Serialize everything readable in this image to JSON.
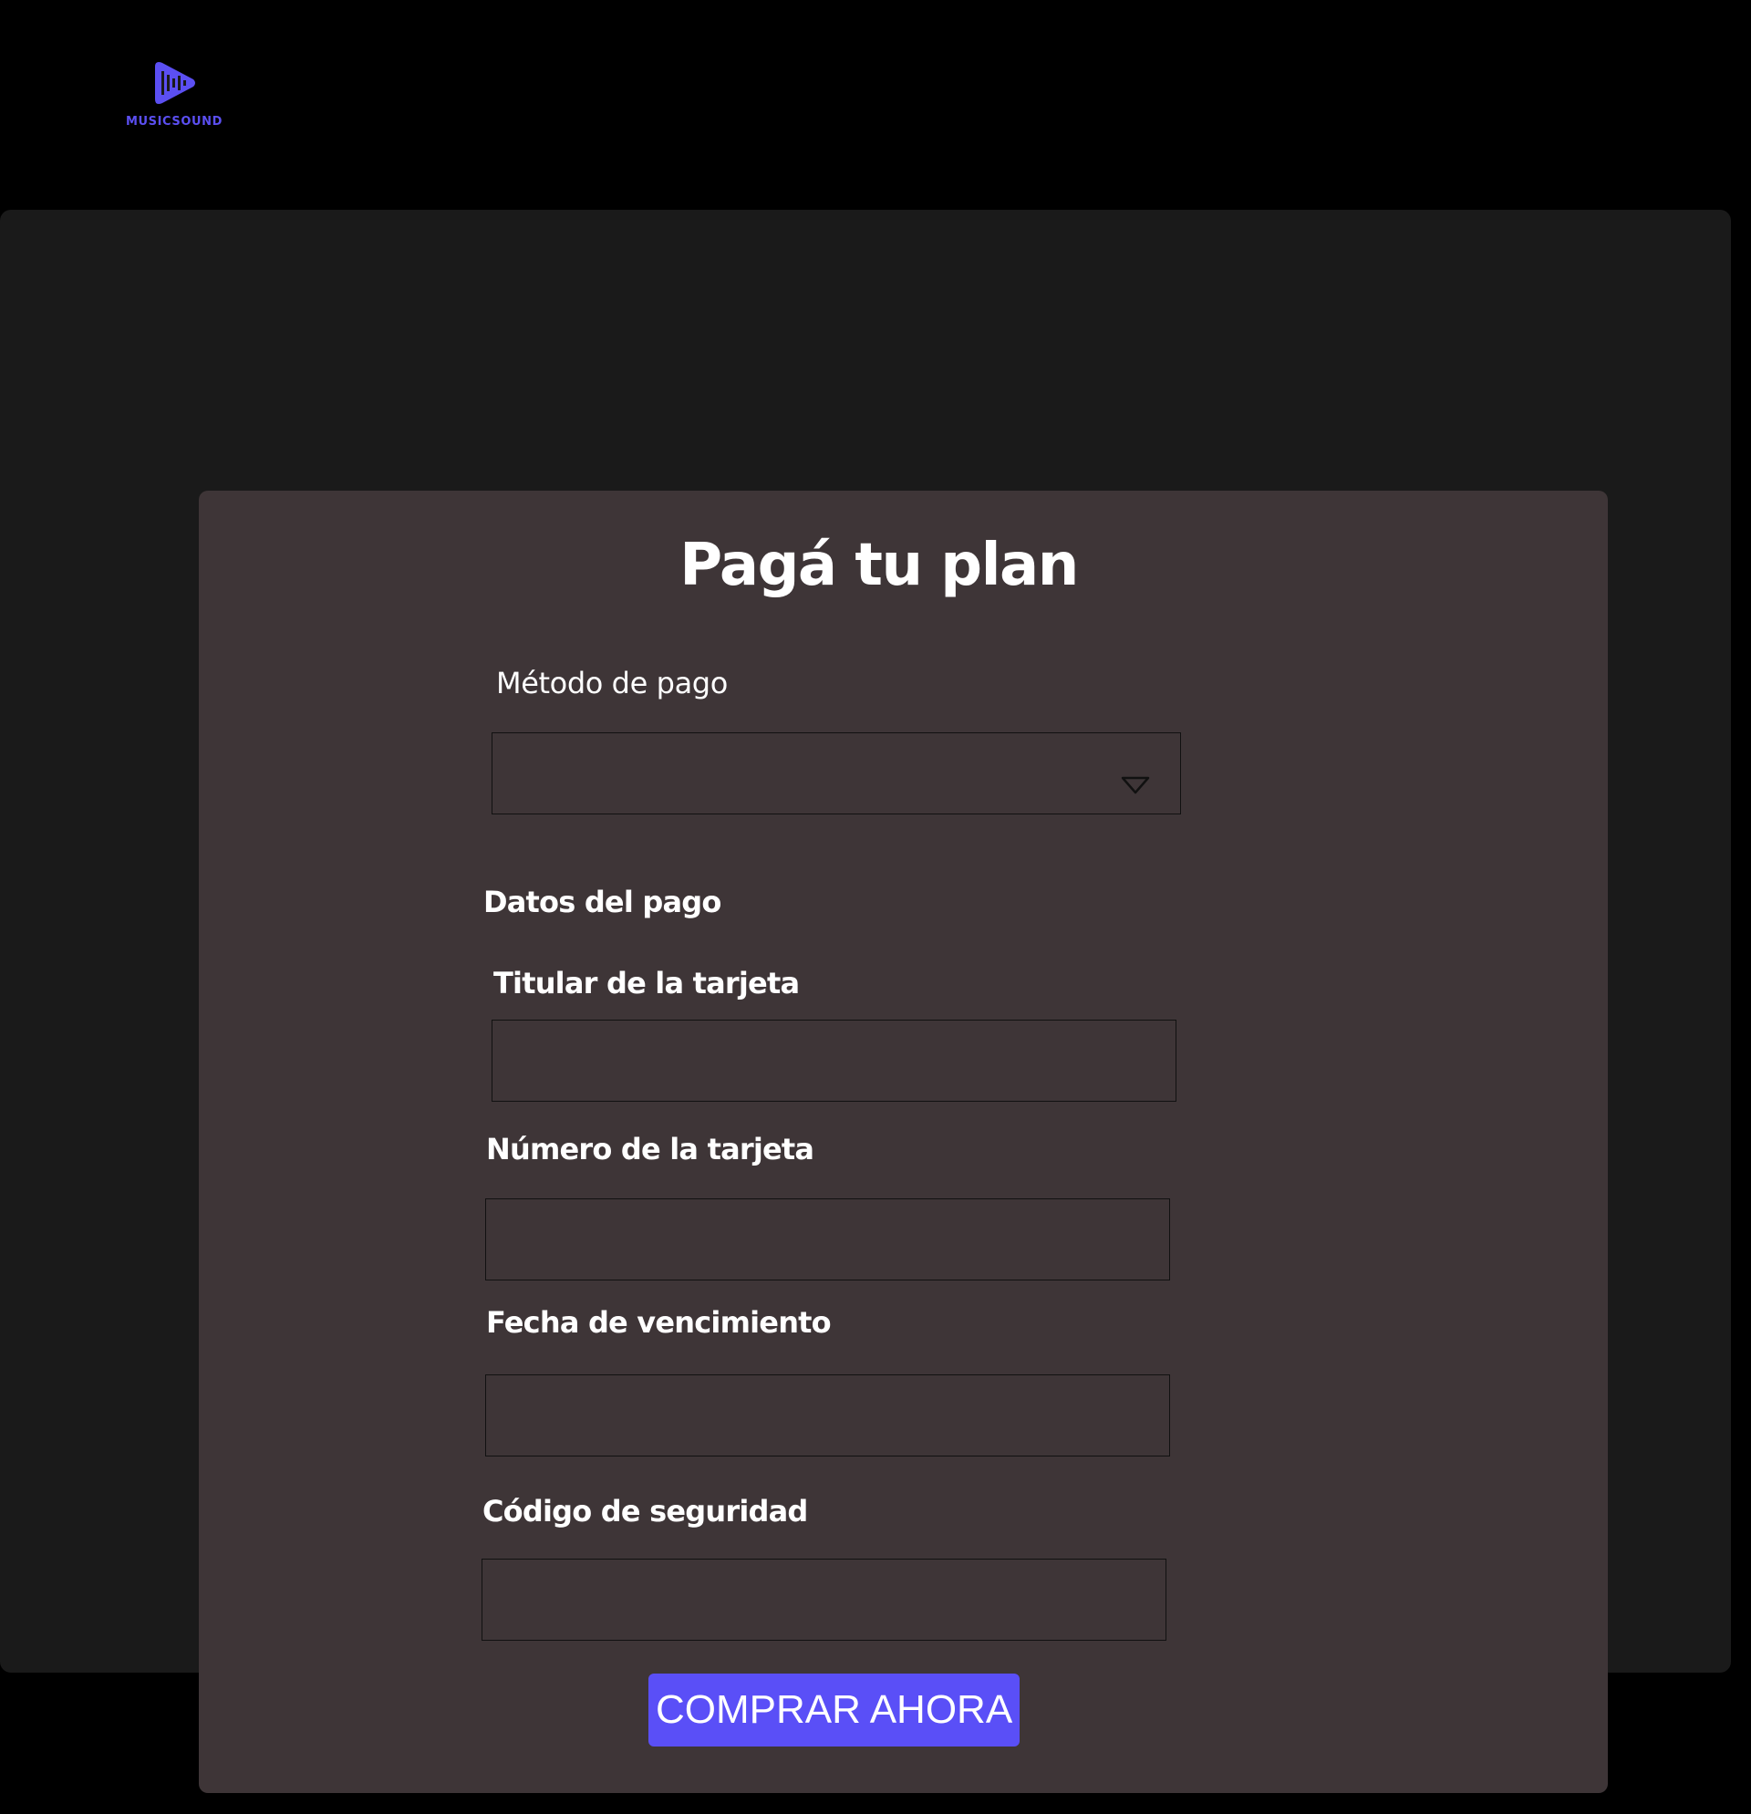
{
  "brand": {
    "name": "MUSICSOUND",
    "icon": "play-soundwave-icon",
    "color": "#5b4ff2"
  },
  "form": {
    "title": "Pagá tu plan",
    "payment_method": {
      "label": "Método de pago",
      "selected_value": ""
    },
    "section_title": "Datos del pago",
    "cardholder": {
      "label": "Titular de la tarjeta",
      "value": ""
    },
    "card_number": {
      "label": "Número de la tarjeta",
      "value": ""
    },
    "expiry": {
      "label": "Fecha de vencimiento",
      "value": ""
    },
    "security_code": {
      "label": "Código de seguridad",
      "value": ""
    },
    "submit_label": "COMPRAR AHORA"
  },
  "colors": {
    "page_background": "#000000",
    "outer_panel": "#1a1a1a",
    "card_background": "#3e3537",
    "accent": "#5a4ff7",
    "text": "#ffffff"
  }
}
